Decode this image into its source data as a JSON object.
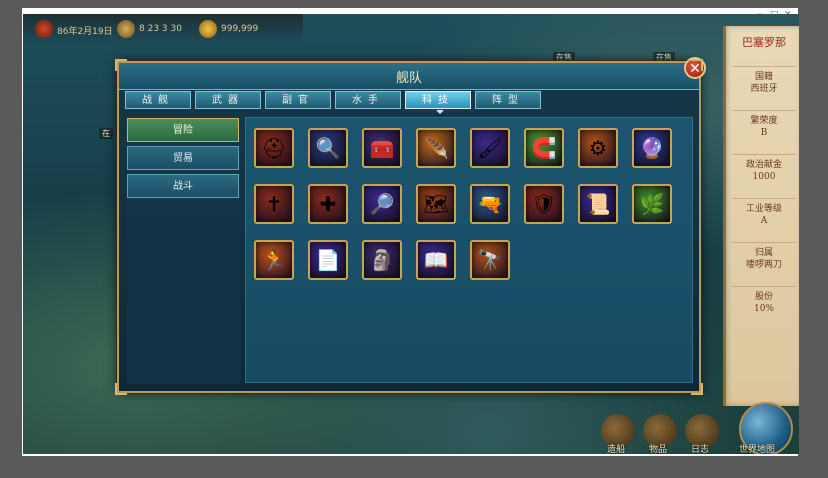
{
  "top_status": {
    "date": "86年2月19日",
    "time_value": "8 23 3 30",
    "gold": "999,999"
  },
  "dialog": {
    "title": "舰队",
    "close_symbol": "✕",
    "tabs": [
      {
        "label": "战舰",
        "active": false
      },
      {
        "label": "武器",
        "active": false
      },
      {
        "label": "副官",
        "active": false
      },
      {
        "label": "水手",
        "active": false
      },
      {
        "label": "科技",
        "active": true
      },
      {
        "label": "阵型",
        "active": false
      }
    ],
    "categories": [
      {
        "label": "冒险",
        "active": true
      },
      {
        "label": "贸易",
        "active": false
      },
      {
        "label": "战斗",
        "active": false
      }
    ],
    "skill_icons": [
      {
        "name": "helmet-plume-icon",
        "glyph": "⛑",
        "bg": "#8a2a1a"
      },
      {
        "name": "magnifier-fish-icon",
        "glyph": "🔍",
        "bg": "#2a3a7a"
      },
      {
        "name": "treasure-chest-icon",
        "glyph": "🧰",
        "bg": "#3a2a6a"
      },
      {
        "name": "golden-feather-icon",
        "glyph": "🪶",
        "bg": "#c06a18"
      },
      {
        "name": "brush-icon",
        "glyph": "🖌",
        "bg": "#3a2a8a"
      },
      {
        "name": "magnet-icon",
        "glyph": "🧲",
        "bg": "#4a9a2a"
      },
      {
        "name": "compass-ring-icon",
        "glyph": "⚙",
        "bg": "#b0501a"
      },
      {
        "name": "crystal-ball-ship-icon",
        "glyph": "🔮",
        "bg": "#2a3a8a"
      },
      {
        "name": "bible-book-icon",
        "glyph": "✝",
        "bg": "#8a2a1a"
      },
      {
        "name": "golden-cross-icon",
        "glyph": "✚",
        "bg": "#8a2a1a"
      },
      {
        "name": "magnifier-plant-icon",
        "glyph": "🔎",
        "bg": "#3a2a8a"
      },
      {
        "name": "treasure-map-icon",
        "glyph": "🗺",
        "bg": "#a0401a"
      },
      {
        "name": "musket-icon",
        "glyph": "🔫",
        "bg": "#2a5a8a"
      },
      {
        "name": "shield-icon",
        "glyph": "🛡",
        "bg": "#8a2a1a"
      },
      {
        "name": "scroll-icon",
        "glyph": "📜",
        "bg": "#3a2a8a"
      },
      {
        "name": "herb-plant-icon",
        "glyph": "🌿",
        "bg": "#3a8a2a"
      },
      {
        "name": "running-man-icon",
        "glyph": "🏃",
        "bg": "#c0501a"
      },
      {
        "name": "paper-sheets-icon",
        "glyph": "📄",
        "bg": "#3a2a8a"
      },
      {
        "name": "golden-idol-icon",
        "glyph": "🗿",
        "bg": "#3a2a6a"
      },
      {
        "name": "open-book-icon",
        "glyph": "📖",
        "bg": "#3a2a8a"
      },
      {
        "name": "telescope-icon",
        "glyph": "🔭",
        "bg": "#b0501a"
      }
    ]
  },
  "side_panel": {
    "title": "巴塞罗那",
    "items": [
      "国籍\n西班牙",
      "繁荣度\nB",
      "政治献金\n1000",
      "工业等级\nA",
      "归属\n喽啰两刀",
      "股份\n10%"
    ]
  },
  "bottom_bar": {
    "buttons": [
      "造船",
      "物品",
      "日志"
    ],
    "world_map": "世界地图"
  },
  "map_labels": [
    "在售",
    "在售",
    "在"
  ]
}
